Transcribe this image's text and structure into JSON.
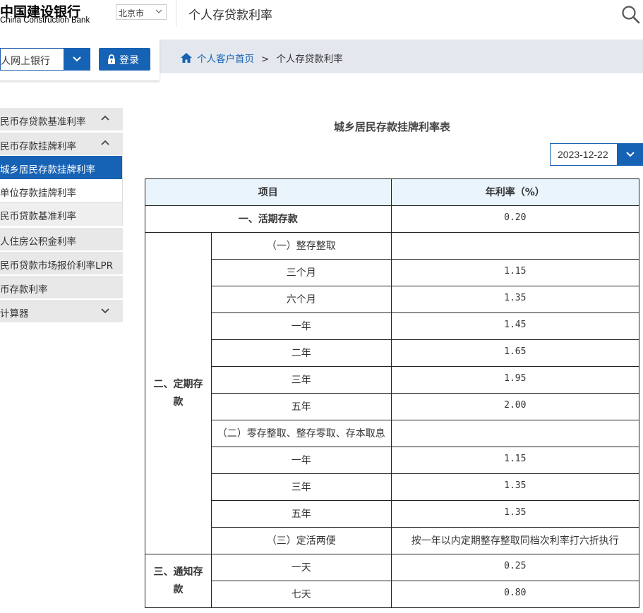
{
  "header": {
    "logo_cn": "中国建设银行",
    "logo_en": "China Construction Bank",
    "city": "北京市",
    "title": "个人存贷款利率"
  },
  "login": {
    "bank_select": "人网上银行",
    "login_label": "登录"
  },
  "breadcrumb": {
    "home": "个人客户首页",
    "separator": ">",
    "current": "个人存贷款利率"
  },
  "sidebar": {
    "items": [
      {
        "label": "民币存贷款基准利率",
        "chevron": "up"
      },
      {
        "label": "民币存款挂牌利率",
        "chevron": "up"
      },
      {
        "label": "城乡居民存款挂牌利率",
        "active": true
      },
      {
        "label": "单位存款挂牌利率"
      },
      {
        "label": "民币贷款基准利率"
      },
      {
        "label": "人住房公积金利率"
      },
      {
        "label": "民币贷款市场报价利率LPR"
      },
      {
        "label": "币存款利率"
      },
      {
        "label": "计算器",
        "chevron": "down"
      }
    ]
  },
  "main": {
    "table_title": "城乡居民存款挂牌利率表",
    "date": "2023-12-22",
    "columns": [
      "项目",
      "年利率（%）"
    ],
    "rows": {
      "current": {
        "label": "一、活期存款",
        "rate": "0.20"
      },
      "fixed_group": "二、定期存款",
      "fixed": [
        {
          "label": "（一）整存整取",
          "rate": ""
        },
        {
          "label": "三个月",
          "rate": "1.15"
        },
        {
          "label": "六个月",
          "rate": "1.35"
        },
        {
          "label": "一年",
          "rate": "1.45"
        },
        {
          "label": "二年",
          "rate": "1.65"
        },
        {
          "label": "三年",
          "rate": "1.95"
        },
        {
          "label": "五年",
          "rate": "2.00"
        },
        {
          "label": "（二）零存整取、整存零取、存本取息",
          "rate": ""
        },
        {
          "label": "一年",
          "rate": "1.15"
        },
        {
          "label": "三年",
          "rate": "1.35"
        },
        {
          "label": "五年",
          "rate": "1.35"
        },
        {
          "label": "（三）定活两便",
          "rate": "按一年以内定期整存整取同档次利率打六折执行"
        }
      ],
      "notice_group": "三、通知存款",
      "notice": [
        {
          "label": "一天",
          "rate": "0.25"
        },
        {
          "label": "七天",
          "rate": "0.80"
        }
      ]
    }
  },
  "colors": {
    "brand_blue": "#1662b4",
    "table_header_bg": "#e9f4fd",
    "sidebar_bg": "#e8e8e8"
  }
}
